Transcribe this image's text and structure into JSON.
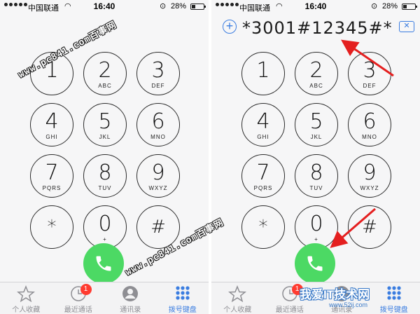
{
  "status_bar": {
    "carrier": "中国联通",
    "time": "16:40",
    "battery_percent": "28%",
    "battery_level": 0.28
  },
  "dialer": {
    "dialed_number": "*3001#12345#*",
    "add_contact_glyph": "+",
    "delete_glyph": "✕"
  },
  "keypad": [
    {
      "digit": "1",
      "letters": ""
    },
    {
      "digit": "2",
      "letters": "ABC"
    },
    {
      "digit": "3",
      "letters": "DEF"
    },
    {
      "digit": "4",
      "letters": "GHI"
    },
    {
      "digit": "5",
      "letters": "JKL"
    },
    {
      "digit": "6",
      "letters": "MNO"
    },
    {
      "digit": "7",
      "letters": "PQRS"
    },
    {
      "digit": "8",
      "letters": "TUV"
    },
    {
      "digit": "9",
      "letters": "WXYZ"
    },
    {
      "digit": "*",
      "letters": ""
    },
    {
      "digit": "0",
      "letters": "+"
    },
    {
      "digit": "#",
      "letters": ""
    }
  ],
  "tab_bar": [
    {
      "label": "个人收藏",
      "icon": "star-icon"
    },
    {
      "label": "最近通话",
      "icon": "clock-icon",
      "badge": "1"
    },
    {
      "label": "通讯录",
      "icon": "contacts-icon"
    },
    {
      "label": "拨号键盘",
      "icon": "keypad-icon",
      "active": true
    }
  ],
  "watermarks": {
    "site": "www.pc841.com百事网",
    "bottom_logo": "我爱IT技术网",
    "bottom_url": "www.52ij.com"
  },
  "colors": {
    "call_green": "#4cd964",
    "accent_blue": "#3b7de0",
    "badge_red": "#ff3b30",
    "arrow_red": "#e41f1f"
  }
}
